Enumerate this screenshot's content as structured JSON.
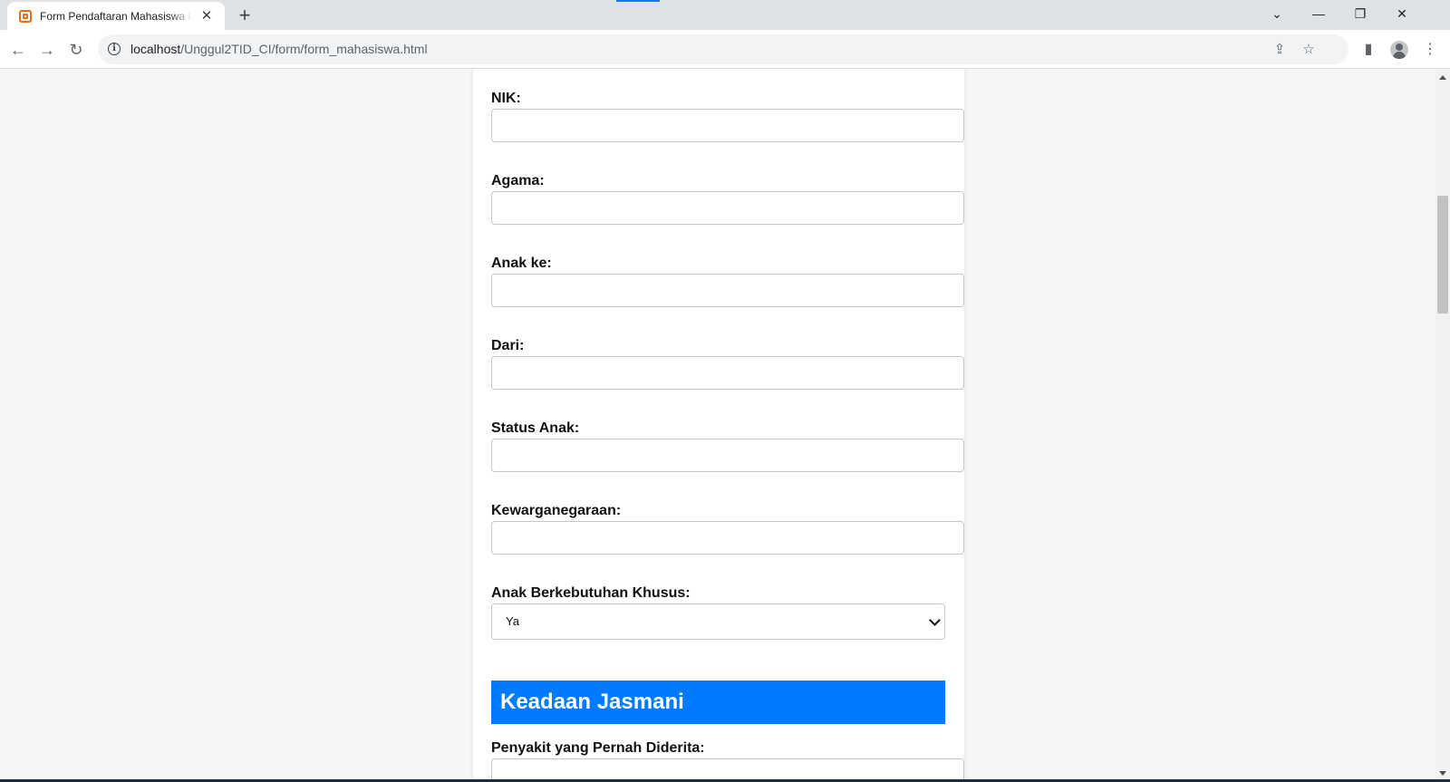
{
  "browser": {
    "tab_title": "Form Pendaftaran Mahasiswa Baru",
    "tab_close": "✕",
    "new_tab": "+",
    "url_host": "localhost",
    "url_path": "/Unggul2TID_CI/form/form_mahasiswa.html",
    "icons": [
      "back-icon",
      "forward-icon",
      "reload-icon",
      "info-icon",
      "share-icon",
      "star-icon",
      "side-panel-icon",
      "profile-icon",
      "menu-icon"
    ]
  },
  "form": {
    "fields": [
      {
        "label": "NIK:",
        "value": ""
      },
      {
        "label": "Agama:",
        "value": ""
      },
      {
        "label": "Anak ke:",
        "value": ""
      },
      {
        "label": "Dari:",
        "value": ""
      },
      {
        "label": "Status Anak:",
        "value": ""
      },
      {
        "label": "Kewarganegaraan:",
        "value": ""
      }
    ],
    "abk": {
      "label": "Anak Berkebutuhan Khusus:",
      "selected": "Ya"
    },
    "section_jasmani": {
      "title": "Keadaan Jasmani",
      "first_label": "Penyakit yang Pernah Diderita:"
    }
  },
  "colors": {
    "section_banner": "#007bff",
    "page_bg": "#f6f6f6"
  }
}
